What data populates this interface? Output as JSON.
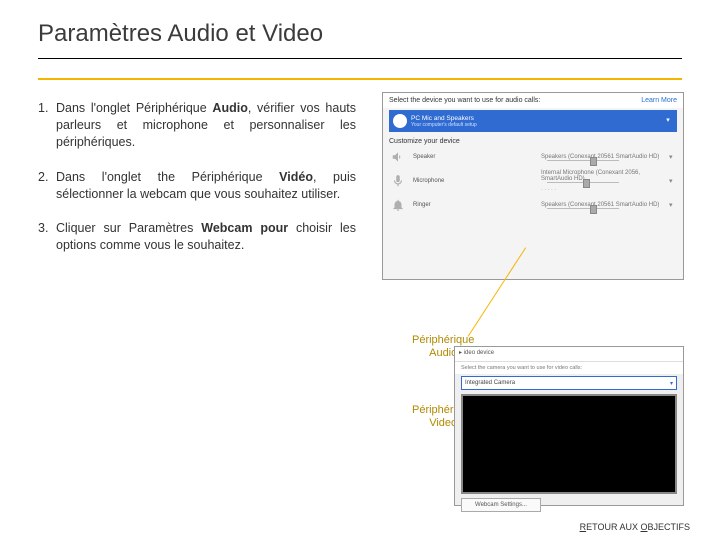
{
  "title": "Paramètres Audio et Video",
  "list": [
    {
      "num": "1.",
      "pre": "Dans l'onglet Périphérique ",
      "bold": "Audio",
      "post": ", vérifier vos hauts parleurs et microphone et personnaliser les périphériques."
    },
    {
      "num": "2.",
      "pre": "Dans l'onglet the Périphérique ",
      "bold": "Vidéo",
      "post": ", puis sélectionner la webcam que vous souhaitez utiliser."
    },
    {
      "num": "3.",
      "pre": "Cliquer sur Paramètres ",
      "bold": "Webcam pour ",
      "post": "choisir les options comme vous le souhaitez."
    }
  ],
  "audio_panel": {
    "header": "Select the device you want to use for audio calls:",
    "learn": "Learn More",
    "sel_line1": "PC Mic and Speakers",
    "sel_line2": "Your computer's default setup",
    "customize": "Customize your device",
    "rows": [
      {
        "label": "Speaker",
        "value": "Speakers (Conexant 20561 SmartAudio HD)",
        "pos": 60
      },
      {
        "label": "Microphone",
        "value": "Internal Microphone (Conexant 2056, SmartAudio HD)",
        "pos": 50
      },
      {
        "label": "Ringer",
        "value": "Speakers (Conexant 20561 SmartAudio HD)",
        "pos": 60
      }
    ]
  },
  "video_panel": {
    "tab": "ideo device",
    "text": "Select the camera you want to use for video calls:",
    "selected": "Integrated Camera",
    "button": "Webcam Settings..."
  },
  "captions": {
    "audio_l1": "Périphérique",
    "audio_l2": "Audio",
    "video_l1": "Périphérique",
    "video_l2": "Video"
  },
  "footer": {
    "r1": "R",
    "etour": "ETOUR",
    "sp": " AUX ",
    "o": "O",
    "rest": "BJECTIFS"
  }
}
